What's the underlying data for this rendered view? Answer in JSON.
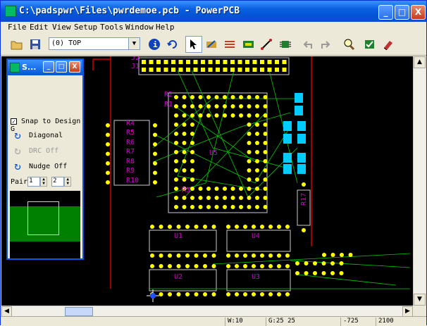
{
  "window": {
    "title": "C:\\padspwr\\Files\\pwrdemoe.pcb - PowerPCB"
  },
  "title_buttons": {
    "minimize": "_",
    "maximize": "□",
    "close": "X"
  },
  "menu": [
    "File",
    "Edit",
    "View",
    "Setup",
    "Tools",
    "Window",
    "Help"
  ],
  "toolbar": {
    "layer_value": "(0) TOP",
    "icons": [
      "open-folder-icon",
      "save-disk-icon",
      "info-icon",
      "redraw-icon",
      "select-arrow-icon",
      "drafting-icon",
      "design-icon",
      "ecofile-icon",
      "route-icon",
      "bga-icon",
      "undo-icon",
      "redo-icon",
      "zoom-icon",
      "verify-icon",
      "erase-icon"
    ]
  },
  "panel": {
    "title": "S...",
    "snap_label": "Snap to Design G",
    "snap_checked": "✓",
    "diagonal_label": "Diagonal",
    "drc_label": "DRC Off",
    "nudge_label": "Nudge Off",
    "pair_label": "Pair",
    "pair_value_1": "1",
    "pair_value_2": "2"
  },
  "board": {
    "components": [
      "J2",
      "J1",
      "R2",
      "R1",
      "R4",
      "R5",
      "R6",
      "R7",
      "R8",
      "R9",
      "R10",
      "U5",
      "R3",
      "R17",
      "U1",
      "U4",
      "U2",
      "U3"
    ],
    "colors": {
      "background": "#000000",
      "pad": "#ffff00",
      "outline": "#cccccc",
      "label": "#cc00cc",
      "trace": "#00cc00",
      "cyan_part": "#00ccff",
      "board_edge": "#cc0000"
    }
  },
  "status": {
    "width": "W:10",
    "grid": "G:25 25",
    "x": "-725",
    "y": "2100"
  }
}
